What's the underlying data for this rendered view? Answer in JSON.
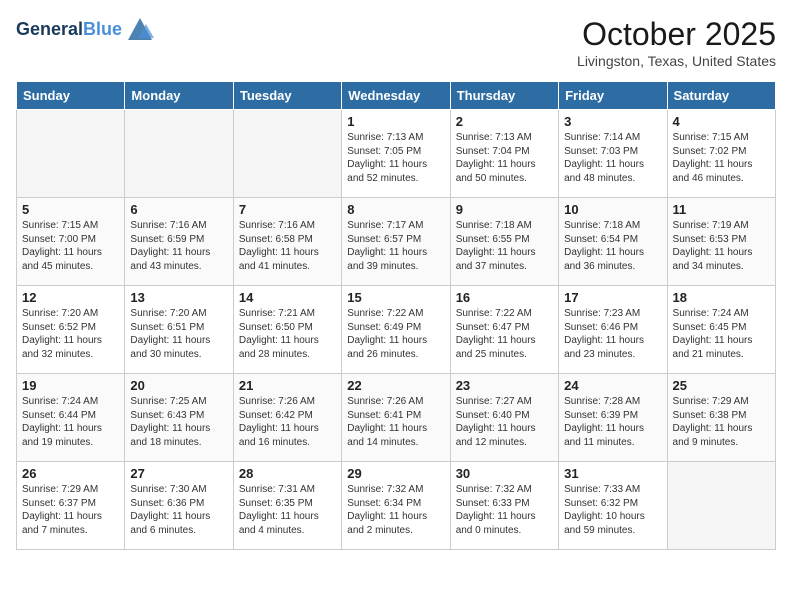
{
  "header": {
    "logo_line1": "General",
    "logo_line2": "Blue",
    "month_title": "October 2025",
    "location": "Livingston, Texas, United States"
  },
  "weekdays": [
    "Sunday",
    "Monday",
    "Tuesday",
    "Wednesday",
    "Thursday",
    "Friday",
    "Saturday"
  ],
  "weeks": [
    [
      {
        "day": "",
        "sunrise": "",
        "sunset": "",
        "daylight": ""
      },
      {
        "day": "",
        "sunrise": "",
        "sunset": "",
        "daylight": ""
      },
      {
        "day": "",
        "sunrise": "",
        "sunset": "",
        "daylight": ""
      },
      {
        "day": "1",
        "sunrise": "Sunrise: 7:13 AM",
        "sunset": "Sunset: 7:05 PM",
        "daylight": "Daylight: 11 hours and 52 minutes."
      },
      {
        "day": "2",
        "sunrise": "Sunrise: 7:13 AM",
        "sunset": "Sunset: 7:04 PM",
        "daylight": "Daylight: 11 hours and 50 minutes."
      },
      {
        "day": "3",
        "sunrise": "Sunrise: 7:14 AM",
        "sunset": "Sunset: 7:03 PM",
        "daylight": "Daylight: 11 hours and 48 minutes."
      },
      {
        "day": "4",
        "sunrise": "Sunrise: 7:15 AM",
        "sunset": "Sunset: 7:02 PM",
        "daylight": "Daylight: 11 hours and 46 minutes."
      }
    ],
    [
      {
        "day": "5",
        "sunrise": "Sunrise: 7:15 AM",
        "sunset": "Sunset: 7:00 PM",
        "daylight": "Daylight: 11 hours and 45 minutes."
      },
      {
        "day": "6",
        "sunrise": "Sunrise: 7:16 AM",
        "sunset": "Sunset: 6:59 PM",
        "daylight": "Daylight: 11 hours and 43 minutes."
      },
      {
        "day": "7",
        "sunrise": "Sunrise: 7:16 AM",
        "sunset": "Sunset: 6:58 PM",
        "daylight": "Daylight: 11 hours and 41 minutes."
      },
      {
        "day": "8",
        "sunrise": "Sunrise: 7:17 AM",
        "sunset": "Sunset: 6:57 PM",
        "daylight": "Daylight: 11 hours and 39 minutes."
      },
      {
        "day": "9",
        "sunrise": "Sunrise: 7:18 AM",
        "sunset": "Sunset: 6:55 PM",
        "daylight": "Daylight: 11 hours and 37 minutes."
      },
      {
        "day": "10",
        "sunrise": "Sunrise: 7:18 AM",
        "sunset": "Sunset: 6:54 PM",
        "daylight": "Daylight: 11 hours and 36 minutes."
      },
      {
        "day": "11",
        "sunrise": "Sunrise: 7:19 AM",
        "sunset": "Sunset: 6:53 PM",
        "daylight": "Daylight: 11 hours and 34 minutes."
      }
    ],
    [
      {
        "day": "12",
        "sunrise": "Sunrise: 7:20 AM",
        "sunset": "Sunset: 6:52 PM",
        "daylight": "Daylight: 11 hours and 32 minutes."
      },
      {
        "day": "13",
        "sunrise": "Sunrise: 7:20 AM",
        "sunset": "Sunset: 6:51 PM",
        "daylight": "Daylight: 11 hours and 30 minutes."
      },
      {
        "day": "14",
        "sunrise": "Sunrise: 7:21 AM",
        "sunset": "Sunset: 6:50 PM",
        "daylight": "Daylight: 11 hours and 28 minutes."
      },
      {
        "day": "15",
        "sunrise": "Sunrise: 7:22 AM",
        "sunset": "Sunset: 6:49 PM",
        "daylight": "Daylight: 11 hours and 26 minutes."
      },
      {
        "day": "16",
        "sunrise": "Sunrise: 7:22 AM",
        "sunset": "Sunset: 6:47 PM",
        "daylight": "Daylight: 11 hours and 25 minutes."
      },
      {
        "day": "17",
        "sunrise": "Sunrise: 7:23 AM",
        "sunset": "Sunset: 6:46 PM",
        "daylight": "Daylight: 11 hours and 23 minutes."
      },
      {
        "day": "18",
        "sunrise": "Sunrise: 7:24 AM",
        "sunset": "Sunset: 6:45 PM",
        "daylight": "Daylight: 11 hours and 21 minutes."
      }
    ],
    [
      {
        "day": "19",
        "sunrise": "Sunrise: 7:24 AM",
        "sunset": "Sunset: 6:44 PM",
        "daylight": "Daylight: 11 hours and 19 minutes."
      },
      {
        "day": "20",
        "sunrise": "Sunrise: 7:25 AM",
        "sunset": "Sunset: 6:43 PM",
        "daylight": "Daylight: 11 hours and 18 minutes."
      },
      {
        "day": "21",
        "sunrise": "Sunrise: 7:26 AM",
        "sunset": "Sunset: 6:42 PM",
        "daylight": "Daylight: 11 hours and 16 minutes."
      },
      {
        "day": "22",
        "sunrise": "Sunrise: 7:26 AM",
        "sunset": "Sunset: 6:41 PM",
        "daylight": "Daylight: 11 hours and 14 minutes."
      },
      {
        "day": "23",
        "sunrise": "Sunrise: 7:27 AM",
        "sunset": "Sunset: 6:40 PM",
        "daylight": "Daylight: 11 hours and 12 minutes."
      },
      {
        "day": "24",
        "sunrise": "Sunrise: 7:28 AM",
        "sunset": "Sunset: 6:39 PM",
        "daylight": "Daylight: 11 hours and 11 minutes."
      },
      {
        "day": "25",
        "sunrise": "Sunrise: 7:29 AM",
        "sunset": "Sunset: 6:38 PM",
        "daylight": "Daylight: 11 hours and 9 minutes."
      }
    ],
    [
      {
        "day": "26",
        "sunrise": "Sunrise: 7:29 AM",
        "sunset": "Sunset: 6:37 PM",
        "daylight": "Daylight: 11 hours and 7 minutes."
      },
      {
        "day": "27",
        "sunrise": "Sunrise: 7:30 AM",
        "sunset": "Sunset: 6:36 PM",
        "daylight": "Daylight: 11 hours and 6 minutes."
      },
      {
        "day": "28",
        "sunrise": "Sunrise: 7:31 AM",
        "sunset": "Sunset: 6:35 PM",
        "daylight": "Daylight: 11 hours and 4 minutes."
      },
      {
        "day": "29",
        "sunrise": "Sunrise: 7:32 AM",
        "sunset": "Sunset: 6:34 PM",
        "daylight": "Daylight: 11 hours and 2 minutes."
      },
      {
        "day": "30",
        "sunrise": "Sunrise: 7:32 AM",
        "sunset": "Sunset: 6:33 PM",
        "daylight": "Daylight: 11 hours and 0 minutes."
      },
      {
        "day": "31",
        "sunrise": "Sunrise: 7:33 AM",
        "sunset": "Sunset: 6:32 PM",
        "daylight": "Daylight: 10 hours and 59 minutes."
      },
      {
        "day": "",
        "sunrise": "",
        "sunset": "",
        "daylight": ""
      }
    ]
  ]
}
